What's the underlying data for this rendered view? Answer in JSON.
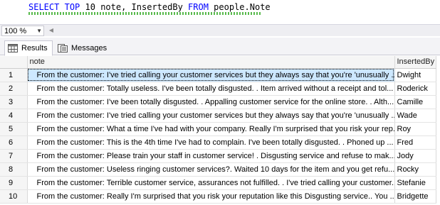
{
  "editor": {
    "kw_select": "SELECT",
    "kw_top": "TOP",
    "num": "10",
    "cols": "note, InsertedBy",
    "kw_from": "FROM",
    "table": "people.Note"
  },
  "zoom": {
    "value": "100 %"
  },
  "tabs": [
    {
      "label": "Results"
    },
    {
      "label": "Messages"
    }
  ],
  "grid": {
    "columns": [
      "note",
      "InsertedBy"
    ],
    "rows": [
      {
        "n": "1",
        "note": "From the customer:   I've tried calling your customer services but they always say that you're 'unusually ...",
        "by": "Dwight"
      },
      {
        "n": "2",
        "note": "From the customer:   Totally useless. I've been totally disgusted. .  Item arrived without a receipt and tol...",
        "by": "Roderick"
      },
      {
        "n": "3",
        "note": "From the customer:   I've been totally disgusted. . Appalling customer service for the online store. .  Alth...",
        "by": "Camille"
      },
      {
        "n": "4",
        "note": "From the customer:   I've tried calling your customer services but they always say that you're 'unusually ...",
        "by": "Wade"
      },
      {
        "n": "5",
        "note": "From the customer:   What a time I've had with your company. Really I'm surprised that you risk your rep...",
        "by": "Roy"
      },
      {
        "n": "6",
        "note": "From the customer:   This is the 4th time I've had to complain. I've been totally disgusted. .  Phoned up ...",
        "by": "Fred"
      },
      {
        "n": "7",
        "note": "From the customer:   Please train your staff in customer service! .  Disgusting service and refuse to mak...",
        "by": "Jody"
      },
      {
        "n": "8",
        "note": "From the customer:   Useless ringing customer services?.  Waited 10 days for the item and you get refu...",
        "by": "Rocky"
      },
      {
        "n": "9",
        "note": "From the customer:   Terrible customer service, assurances not fulfilled. .  I've tried calling your customer...",
        "by": "Stefanie"
      },
      {
        "n": "10",
        "note": "From the customer:   Really I'm surprised that you risk your reputation like this Disgusting service.. You ...",
        "by": "Bridgette"
      }
    ]
  }
}
